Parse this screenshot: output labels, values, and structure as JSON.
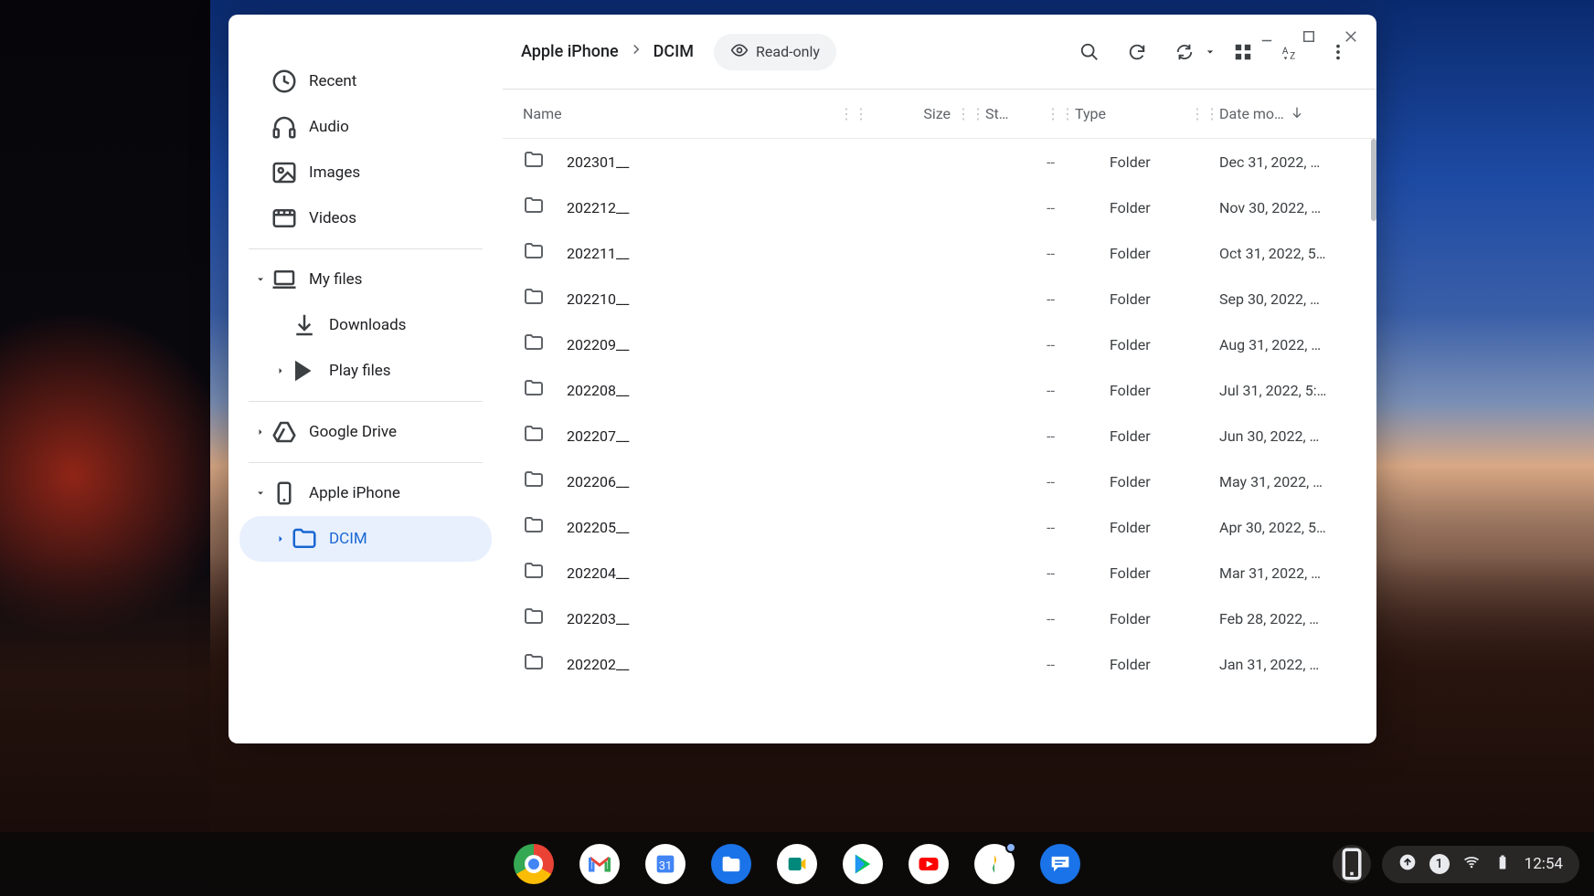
{
  "sidebar": {
    "recent": "Recent",
    "audio": "Audio",
    "images": "Images",
    "videos": "Videos",
    "my_files": "My files",
    "downloads": "Downloads",
    "play_files": "Play files",
    "google_drive": "Google Drive",
    "apple_iphone": "Apple iPhone",
    "dcim": "DCIM"
  },
  "breadcrumb": {
    "a": "Apple iPhone",
    "b": "DCIM"
  },
  "readonly_label": "Read-only",
  "columns": {
    "name": "Name",
    "size": "Size",
    "status": "St…",
    "type": "Type",
    "date": "Date mo…"
  },
  "rows": [
    {
      "name": "202301__",
      "size": "--",
      "type": "Folder",
      "date": "Dec 31, 2022, …"
    },
    {
      "name": "202212__",
      "size": "--",
      "type": "Folder",
      "date": "Nov 30, 2022, …"
    },
    {
      "name": "202211__",
      "size": "--",
      "type": "Folder",
      "date": "Oct 31, 2022, 5…"
    },
    {
      "name": "202210__",
      "size": "--",
      "type": "Folder",
      "date": "Sep 30, 2022, …"
    },
    {
      "name": "202209__",
      "size": "--",
      "type": "Folder",
      "date": "Aug 31, 2022, …"
    },
    {
      "name": "202208__",
      "size": "--",
      "type": "Folder",
      "date": "Jul 31, 2022, 5:…"
    },
    {
      "name": "202207__",
      "size": "--",
      "type": "Folder",
      "date": "Jun 30, 2022, …"
    },
    {
      "name": "202206__",
      "size": "--",
      "type": "Folder",
      "date": "May 31, 2022, …"
    },
    {
      "name": "202205__",
      "size": "--",
      "type": "Folder",
      "date": "Apr 30, 2022, 5…"
    },
    {
      "name": "202204__",
      "size": "--",
      "type": "Folder",
      "date": "Mar 31, 2022, …"
    },
    {
      "name": "202203__",
      "size": "--",
      "type": "Folder",
      "date": "Feb 28, 2022, …"
    },
    {
      "name": "202202__",
      "size": "--",
      "type": "Folder",
      "date": "Jan 31, 2022, …"
    }
  ],
  "shelf": {
    "time": "12:54",
    "notif_count": "1"
  }
}
